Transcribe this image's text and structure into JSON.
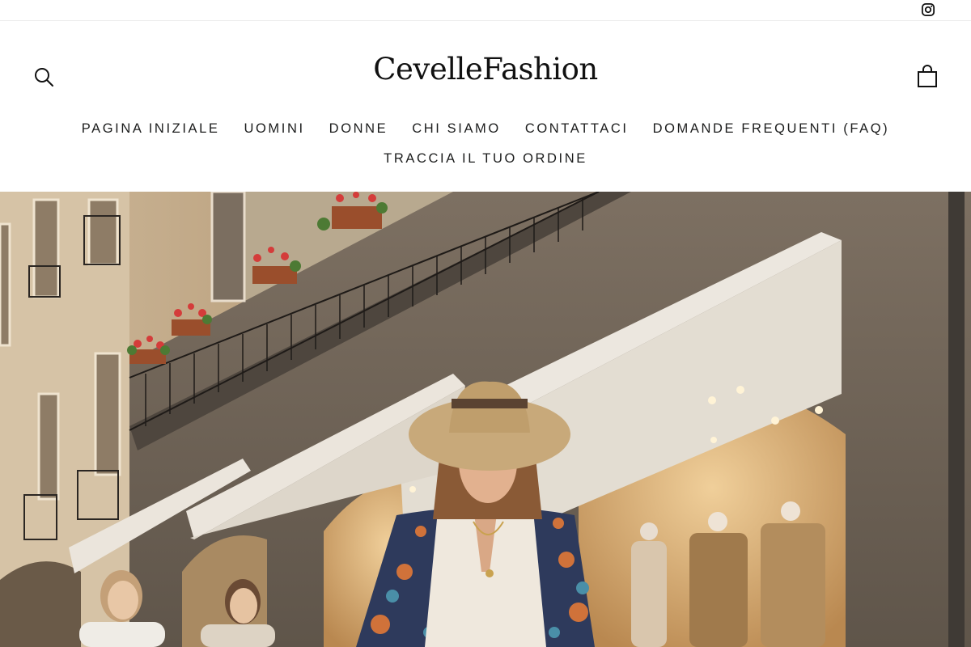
{
  "topbar": {
    "instagram_icon": "instagram-icon"
  },
  "header": {
    "logo_text": "CevelleFashion",
    "search_icon": "search-icon",
    "cart_icon": "cart-bag-icon"
  },
  "nav": {
    "items": [
      {
        "label": "PAGINA INIZIALE"
      },
      {
        "label": "UOMINI"
      },
      {
        "label": "DONNE"
      },
      {
        "label": "CHI SIAMO"
      },
      {
        "label": "CONTATTACI"
      },
      {
        "label": "DOMANDE FREQUENTI (FAQ)"
      },
      {
        "label": "TRACCIA IL TUO ORDINE"
      }
    ]
  },
  "hero": {
    "image_description": "Woman in straw hat and floral kimono walking past a boutique with mannequins and white awnings",
    "colors": {
      "stone": "#8a7d6c",
      "awning": "#e9e4dc",
      "shop_light": "#d9b27c"
    }
  }
}
